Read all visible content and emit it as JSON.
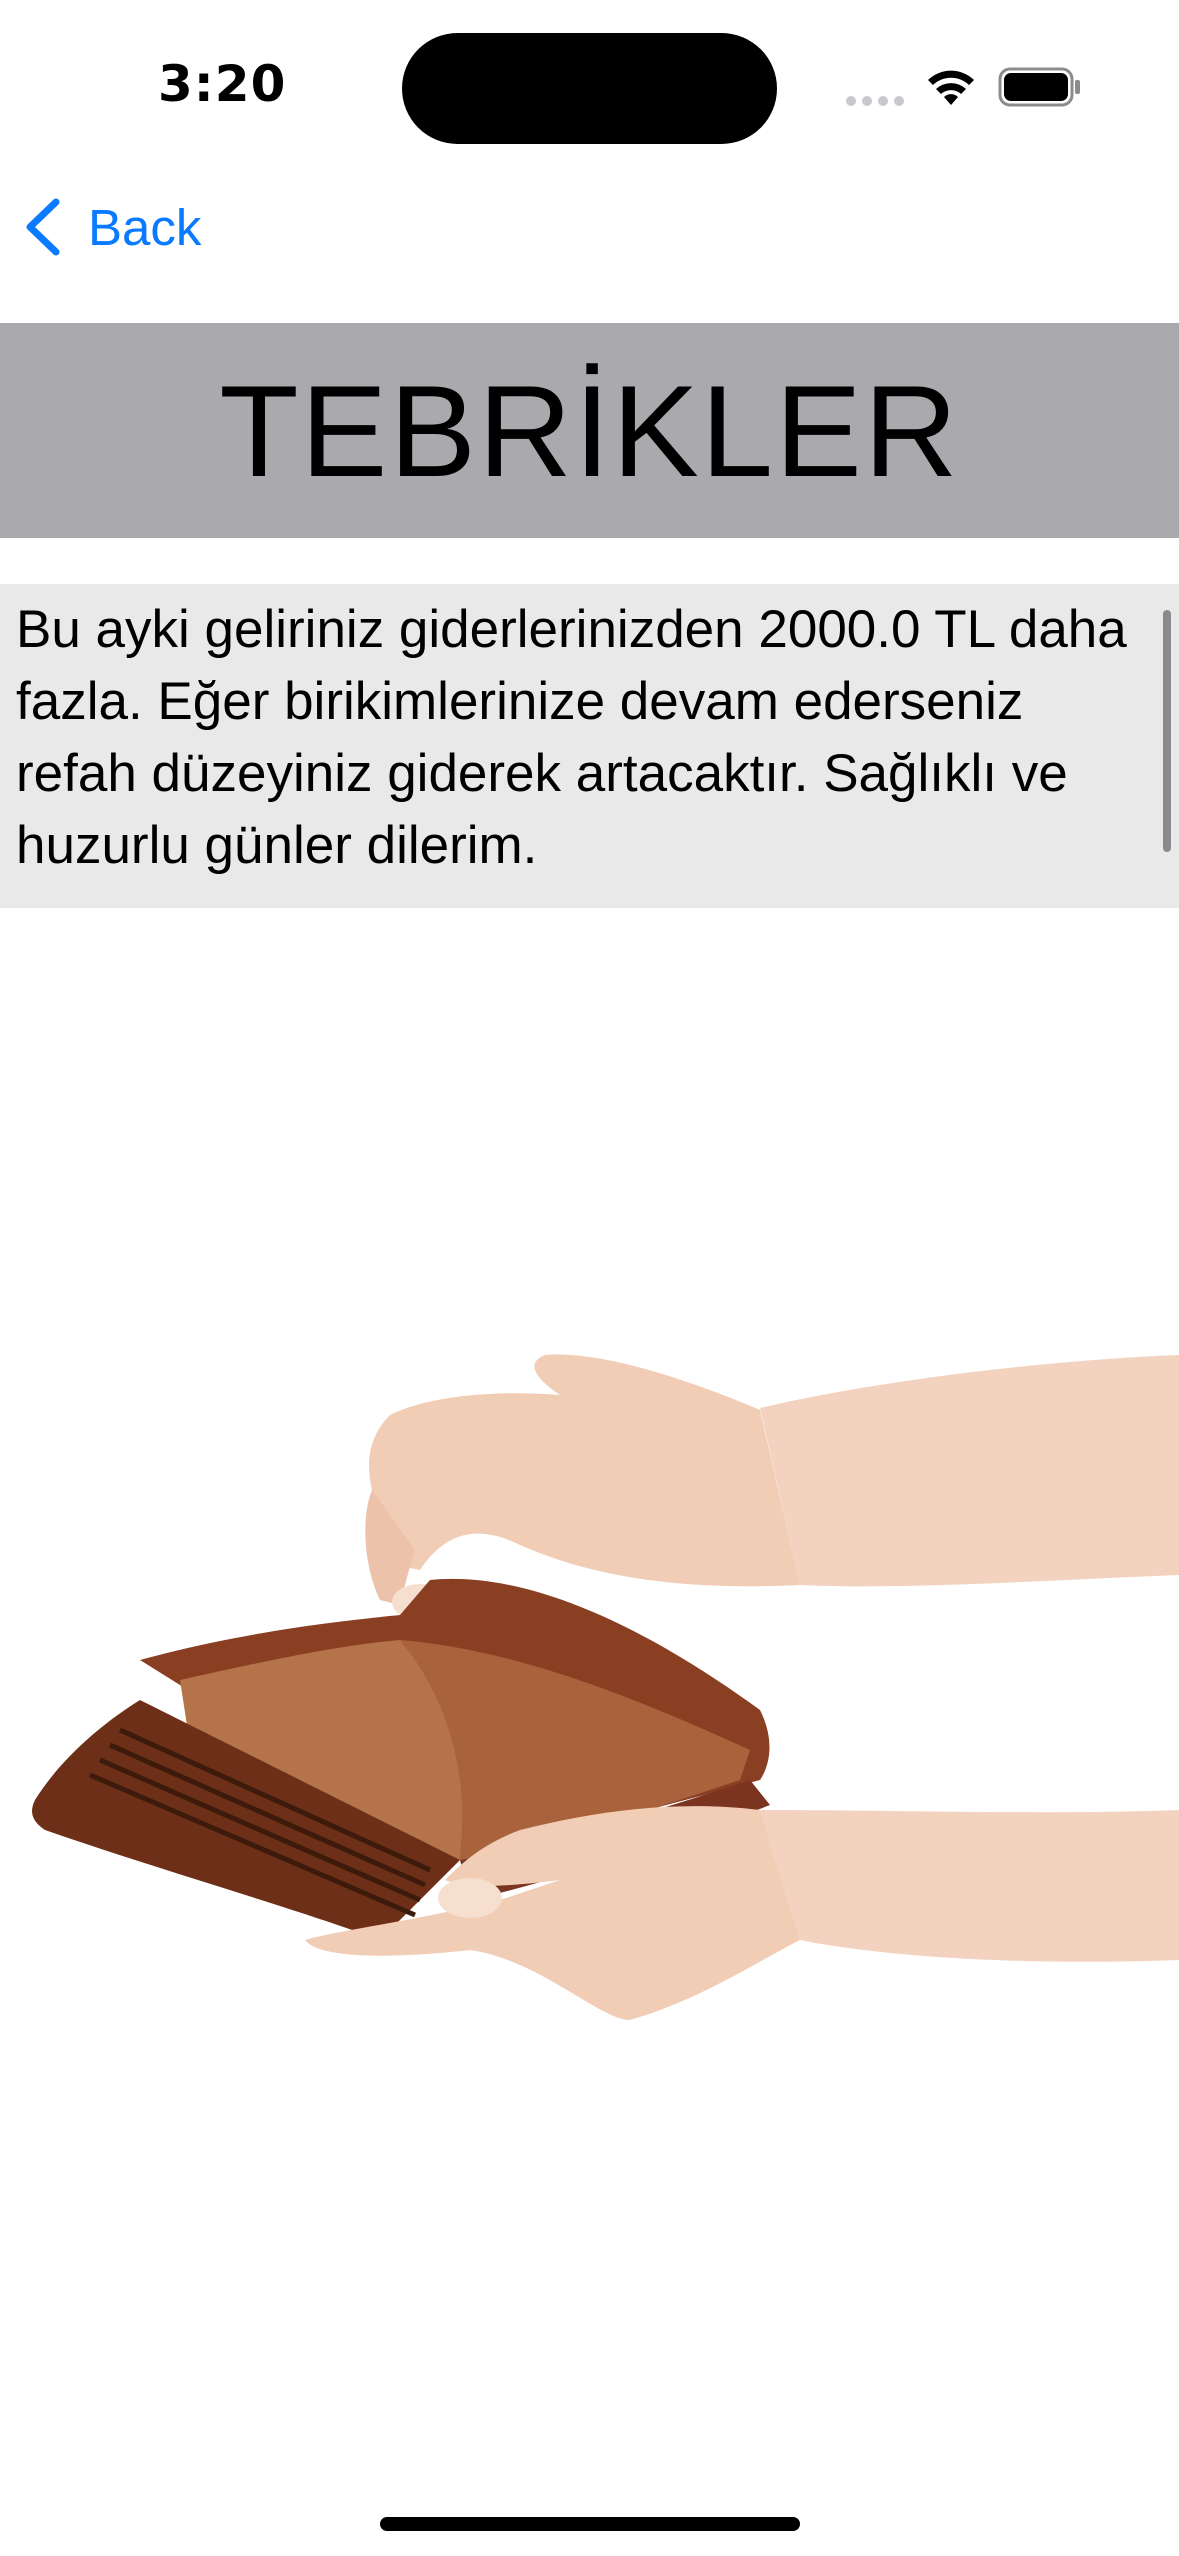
{
  "status_bar": {
    "time": "3:20",
    "icons": [
      "cellular-signal-icon",
      "wifi-icon",
      "battery-icon"
    ]
  },
  "nav": {
    "back_label": "Back",
    "back_icon": "chevron-left-icon"
  },
  "title": "TEBRİKLER",
  "message": "Bu ayki geliriniz giderlerinizden 2000.0 TL daha fazla. Eğer birikimlerinize devam ederseniz refah düzeyiniz giderek artacaktır. Sağlıklı ve huzurlu günler dilerim.",
  "image": {
    "subject": "hands-opening-empty-wallet"
  },
  "colors": {
    "accent": "#0a7aff",
    "title_banner_bg": "#a9a9ae",
    "message_bg": "#e9e9e9",
    "wallet": "#7a3a22",
    "wallet_inner": "#b5734a",
    "skin": "#f1cdb6"
  }
}
